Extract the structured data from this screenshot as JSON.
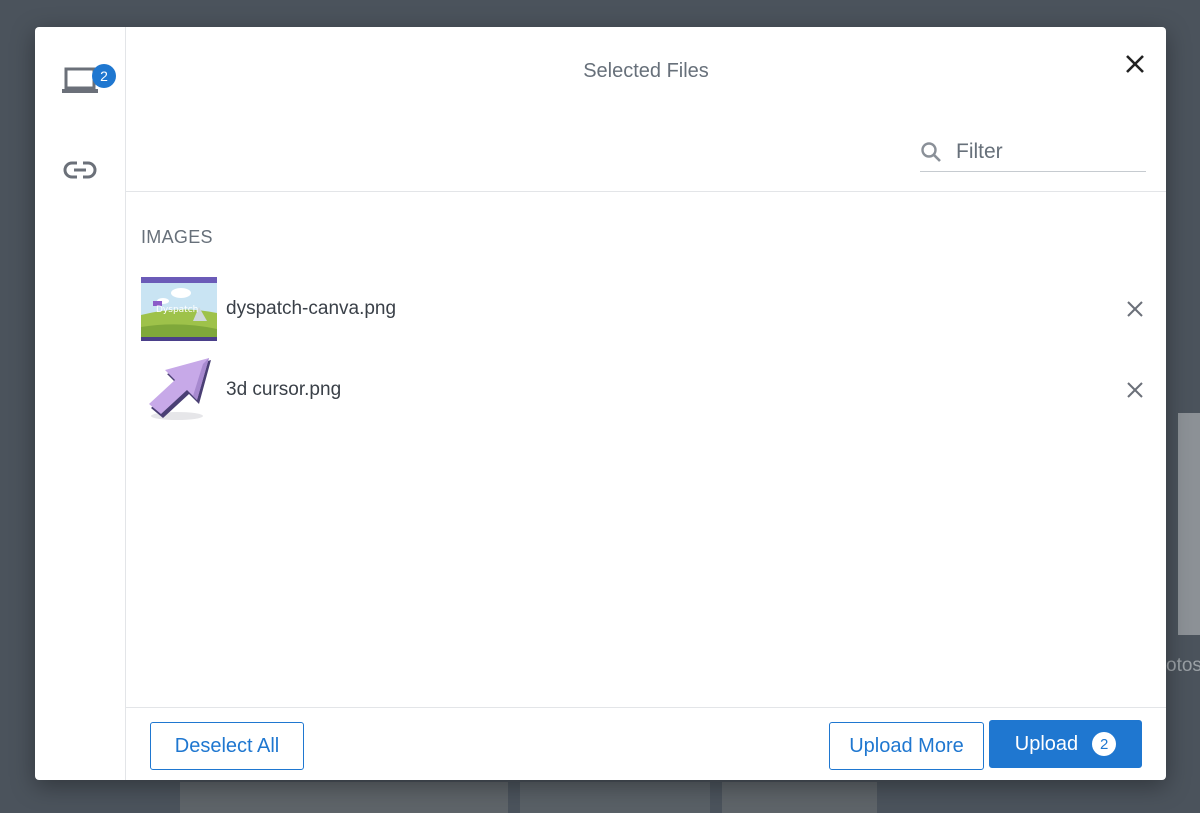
{
  "background": {
    "peek_text": "otos"
  },
  "sidebar": {
    "items": [
      {
        "name": "my-device",
        "icon": "laptop-icon",
        "badge": "2"
      },
      {
        "name": "link",
        "icon": "link-icon"
      }
    ]
  },
  "header": {
    "title": "Selected Files"
  },
  "filter": {
    "placeholder": "Filter",
    "value": ""
  },
  "section": {
    "label": "IMAGES"
  },
  "files": [
    {
      "name": "dyspatch-canva.png",
      "thumb_text": "Dyspatch",
      "remove_icon": "close-icon"
    },
    {
      "name": "3d cursor.png",
      "remove_icon": "close-icon"
    }
  ],
  "footer": {
    "deselect_label": "Deselect All",
    "upload_more_label": "Upload More",
    "upload_label": "Upload",
    "upload_count": "2"
  },
  "colors": {
    "accent": "#1f77d0",
    "text_muted": "#67707a",
    "overlay": "#4b535c"
  }
}
